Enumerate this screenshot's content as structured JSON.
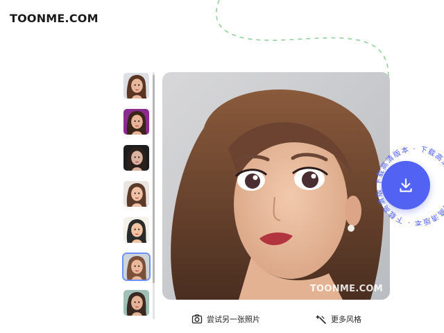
{
  "header": {
    "logo": "TOONME.COM"
  },
  "thumbnails": [
    {
      "name": "thumb-1",
      "skin": "#e9b79b",
      "hair": "#5a3524",
      "bg": "#dcdfe3"
    },
    {
      "name": "thumb-2",
      "skin": "#e8b497",
      "hair": "#3b2418",
      "bg": "#8a2c8f"
    },
    {
      "name": "thumb-3",
      "skin": "#d9b2a0",
      "hair": "#2b201c",
      "bg": "#1d1d1d"
    },
    {
      "name": "thumb-4",
      "skin": "#efc2a5",
      "hair": "#5c3a2a",
      "bg": "#e9e4df"
    },
    {
      "name": "thumb-5",
      "skin": "#f0c4a2",
      "hair": "#2a2a2a",
      "bg": "#f4f1ea"
    },
    {
      "name": "thumb-6",
      "skin": "#eab89a",
      "hair": "#7a5038",
      "bg": "#cfd4da",
      "selected": true
    },
    {
      "name": "thumb-7",
      "skin": "#e6b396",
      "hair": "#3a2a22",
      "bg": "#9fc0b4"
    }
  ],
  "preview": {
    "watermark": "TOONME.COM"
  },
  "download": {
    "badge_text": "下载高清版本 · 下载高清版本 · ",
    "accent": "#5263f4"
  },
  "actions": {
    "try_another": "尝试另一张照片",
    "more_styles": "更多风格"
  },
  "colors": {
    "accent_dashed_curve": "#8fd39a",
    "selected_border": "#6e8ff7"
  }
}
